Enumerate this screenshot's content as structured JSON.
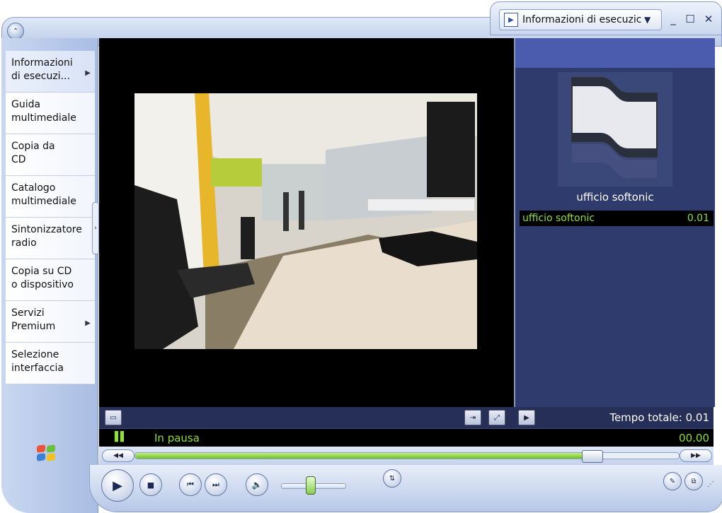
{
  "title_bar": {
    "view_label": "Informazioni di esecuzic",
    "minimize_symbol": "_",
    "maximize_symbol": "☐",
    "close_symbol": "✕"
  },
  "sidebar": {
    "items": [
      {
        "label": "Informazioni\ndi esecuzi...",
        "has_submenu": true,
        "active": true
      },
      {
        "label": "Guida\nmultimediale",
        "has_submenu": false
      },
      {
        "label": "Copia da\nCD",
        "has_submenu": false
      },
      {
        "label": "Catalogo\nmultimediale",
        "has_submenu": false
      },
      {
        "label": "Sintonizzatore\nradio",
        "has_submenu": false
      },
      {
        "label": "Copia su CD\no dispositivo",
        "has_submenu": false
      },
      {
        "label": "Servizi\nPremium",
        "has_submenu": true
      },
      {
        "label": "Selezione\ninterfaccia",
        "has_submenu": false
      }
    ]
  },
  "now_playing": {
    "album_title": "ufficio softonic",
    "playlist": [
      {
        "title": "ufficio softonic",
        "duration": "0.01"
      }
    ],
    "total_time_label": "Tempo totale: 0.01"
  },
  "status": {
    "state": "In pausa",
    "time": "00.00"
  },
  "seek": {
    "progress": 0.84
  },
  "volume": {
    "level": 0.45
  },
  "colors": {
    "status_green": "#8edf3c",
    "panel_blue": "#2e3b6c",
    "header_blue": "#4b5cae"
  },
  "icons": {
    "menu": "chevron-circle-icon",
    "play": "play-icon",
    "stop": "stop-icon",
    "previous": "previous-icon",
    "next": "next-icon",
    "mute": "speaker-icon",
    "shuffle": "equalizer-icon",
    "skin": "skin-icon",
    "mini": "mini-player-icon"
  }
}
